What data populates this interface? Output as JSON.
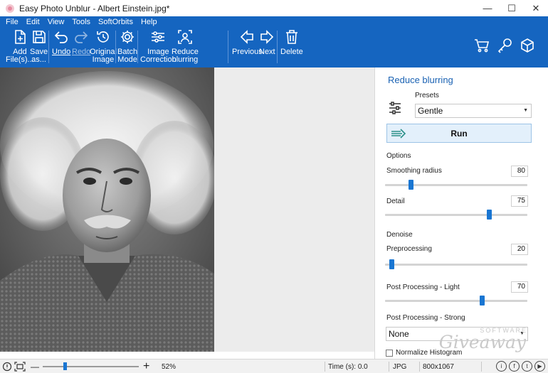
{
  "window": {
    "title": "Easy Photo Unblur - Albert Einstein.jpg*",
    "controls": {
      "minimize": "—",
      "maximize": "☐",
      "close": "✕"
    }
  },
  "menu": {
    "items": [
      "File",
      "Edit",
      "View",
      "Tools",
      "SoftOrbits",
      "Help"
    ]
  },
  "toolbar": {
    "add_files": [
      "Add",
      "File(s)..."
    ],
    "save_as": [
      "Save",
      "as..."
    ],
    "undo": "Undo",
    "redo": "Redo",
    "original_image": [
      "Original",
      "Image"
    ],
    "batch_mode": [
      "Batch",
      "Mode"
    ],
    "image_correction": [
      "Image",
      "Correction"
    ],
    "reduce_blurring": [
      "Reduce",
      "blurring"
    ],
    "previous": "Previous",
    "next": "Next",
    "delete": "Delete",
    "right_icons": [
      "cart-icon",
      "key-icon",
      "box-icon"
    ]
  },
  "panel": {
    "title": "Reduce blurring",
    "presets_label": "Presets",
    "preset_value": "Gentle",
    "run_label": "Run",
    "options_label": "Options",
    "smoothing_radius": {
      "label": "Smoothing radius",
      "value": "80",
      "slider_fraction": 0.17
    },
    "detail": {
      "label": "Detail",
      "value": "75",
      "slider_fraction": 0.74
    },
    "denoise_label": "Denoise",
    "preprocessing": {
      "label": "Preprocessing",
      "value": "20",
      "slider_fraction": 0.03
    },
    "post_light": {
      "label": "Post Processing - Light",
      "value": "70",
      "slider_fraction": 0.69
    },
    "post_strong": {
      "label": "Post Processing - Strong",
      "value": "None"
    },
    "normalize_histogram": {
      "label": "Normalize Histogram",
      "checked": false
    }
  },
  "watermark": {
    "small": "SOFTWARE",
    "big": "Giveaway"
  },
  "statusbar": {
    "zoom_minus": "—",
    "zoom_plus": "+",
    "zoom_level": "52%",
    "time": "Time (s): 0.0",
    "format": "JPG",
    "dimensions": "800x1067",
    "social": [
      "i",
      "f",
      "t",
      "▶"
    ]
  },
  "colors": {
    "ribbon": "#1565c0",
    "accent": "#1976d2",
    "panel_title": "#1a62b3"
  }
}
